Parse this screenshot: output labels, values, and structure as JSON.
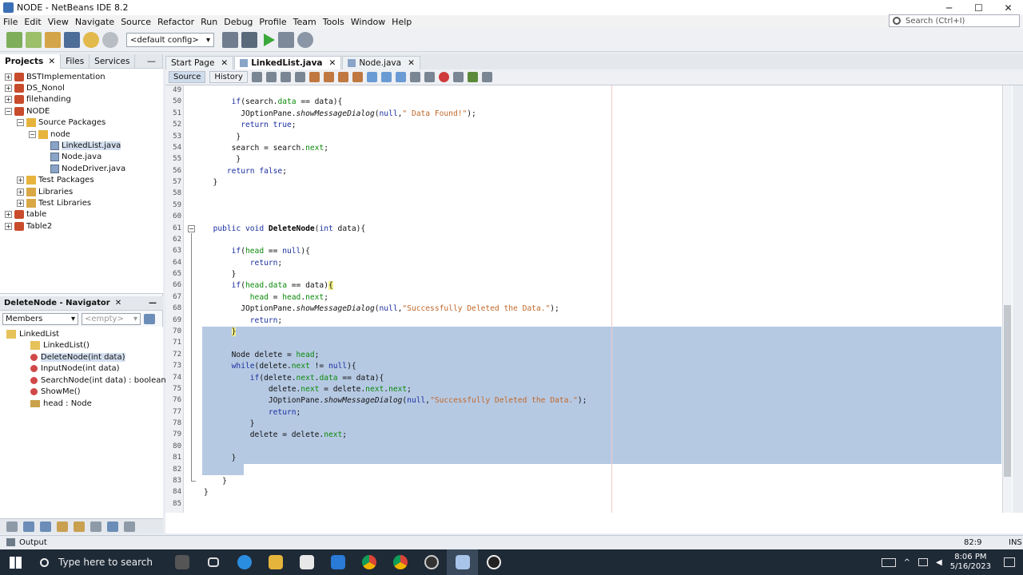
{
  "window": {
    "title": "NODE - NetBeans IDE 8.2",
    "min": "─",
    "max": "☐",
    "close": "✕"
  },
  "menu": [
    "File",
    "Edit",
    "View",
    "Navigate",
    "Source",
    "Refactor",
    "Run",
    "Debug",
    "Profile",
    "Team",
    "Tools",
    "Window",
    "Help"
  ],
  "search": {
    "placeholder": "Search (Ctrl+I)"
  },
  "toolbar": {
    "config": "<default config>"
  },
  "left_tabs": [
    "Projects",
    "Files",
    "Services"
  ],
  "project_tree": [
    {
      "label": "BSTImplementation",
      "level": 0,
      "kind": "proj",
      "exp": "+"
    },
    {
      "label": "DS_Nonol",
      "level": 0,
      "kind": "proj",
      "exp": "+"
    },
    {
      "label": "filehanding",
      "level": 0,
      "kind": "proj",
      "exp": "+"
    },
    {
      "label": "NODE",
      "level": 0,
      "kind": "proj",
      "exp": "−"
    },
    {
      "label": "Source Packages",
      "level": 1,
      "kind": "pkg",
      "exp": "−"
    },
    {
      "label": "node",
      "level": 2,
      "kind": "pkg",
      "exp": "−"
    },
    {
      "label": "LinkedList.java",
      "level": 3,
      "kind": "java",
      "exp": "",
      "selected": true
    },
    {
      "label": "Node.java",
      "level": 3,
      "kind": "java",
      "exp": ""
    },
    {
      "label": "NodeDriver.java",
      "level": 3,
      "kind": "java",
      "exp": ""
    },
    {
      "label": "Test Packages",
      "level": 1,
      "kind": "pkg",
      "exp": "+"
    },
    {
      "label": "Libraries",
      "level": 1,
      "kind": "folder",
      "exp": "+"
    },
    {
      "label": "Test Libraries",
      "level": 1,
      "kind": "folder",
      "exp": "+"
    },
    {
      "label": "table",
      "level": 0,
      "kind": "proj",
      "exp": "+"
    },
    {
      "label": "Table2",
      "level": 0,
      "kind": "proj",
      "exp": "+"
    }
  ],
  "navigator": {
    "title": "DeleteNode - Navigator",
    "members": "Members",
    "filter": "<empty>",
    "items": [
      {
        "label": "LinkedList",
        "level": 0,
        "kind": "cls"
      },
      {
        "label": "LinkedList()",
        "level": 1,
        "kind": "cons"
      },
      {
        "label": "DeleteNode(int data)",
        "level": 1,
        "kind": "meth",
        "selected": true
      },
      {
        "label": "InputNode(int data)",
        "level": 1,
        "kind": "meth"
      },
      {
        "label": "SearchNode(int data) : boolean",
        "level": 1,
        "kind": "meth"
      },
      {
        "label": "ShowMe()",
        "level": 1,
        "kind": "meth"
      },
      {
        "label": "head : Node",
        "level": 1,
        "kind": "fld"
      }
    ]
  },
  "editor_tabs": [
    {
      "label": "Start Page",
      "active": false
    },
    {
      "label": "LinkedList.java",
      "active": true
    },
    {
      "label": "Node.java",
      "active": false
    }
  ],
  "editor_views": [
    "Source",
    "History"
  ],
  "code": [
    {
      "n": "49",
      "t": []
    },
    {
      "n": "50",
      "t": [
        [
          "      ",
          ""
        ],
        [
          "if",
          "kw"
        ],
        [
          "(search.",
          ""
        ],
        [
          "data",
          "fld"
        ],
        [
          " == data){",
          ""
        ]
      ]
    },
    {
      "n": "51",
      "t": [
        [
          "        JOptionPane.",
          ""
        ],
        [
          "showMessageDialog",
          "it"
        ],
        [
          "(",
          ""
        ],
        [
          "null",
          "kw"
        ],
        [
          ",",
          ""
        ],
        [
          "\" Data Found!\"",
          "str"
        ],
        [
          ");",
          ""
        ]
      ]
    },
    {
      "n": "52",
      "t": [
        [
          "        ",
          ""
        ],
        [
          "return true",
          "kw"
        ],
        [
          ";",
          ""
        ]
      ]
    },
    {
      "n": "53",
      "t": [
        [
          "       }",
          ""
        ]
      ]
    },
    {
      "n": "54",
      "t": [
        [
          "      search = search.",
          ""
        ],
        [
          "next",
          "fld"
        ],
        [
          ";",
          ""
        ]
      ]
    },
    {
      "n": "55",
      "t": [
        [
          "       }",
          ""
        ]
      ]
    },
    {
      "n": "56",
      "t": [
        [
          "     ",
          ""
        ],
        [
          "return false",
          "kw"
        ],
        [
          ";",
          ""
        ]
      ]
    },
    {
      "n": "57",
      "t": [
        [
          "  }",
          ""
        ]
      ]
    },
    {
      "n": "58",
      "t": []
    },
    {
      "n": "59",
      "t": []
    },
    {
      "n": "60",
      "t": []
    },
    {
      "n": "61",
      "t": [
        [
          "  ",
          ""
        ],
        [
          "public void",
          "kw"
        ],
        [
          " ",
          ""
        ],
        [
          "DeleteNode",
          "fn"
        ],
        [
          "(",
          ""
        ],
        [
          "int",
          "kw"
        ],
        [
          " data){",
          ""
        ]
      ]
    },
    {
      "n": "62",
      "t": []
    },
    {
      "n": "63",
      "t": [
        [
          "      ",
          ""
        ],
        [
          "if",
          "kw"
        ],
        [
          "(",
          ""
        ],
        [
          "head",
          "fld"
        ],
        [
          " == ",
          ""
        ],
        [
          "null",
          "kw"
        ],
        [
          "){",
          ""
        ]
      ]
    },
    {
      "n": "64",
      "t": [
        [
          "          ",
          ""
        ],
        [
          "return",
          "kw"
        ],
        [
          ";",
          ""
        ]
      ]
    },
    {
      "n": "65",
      "t": [
        [
          "      }",
          ""
        ]
      ]
    },
    {
      "n": "66",
      "t": [
        [
          "      ",
          ""
        ],
        [
          "if",
          "kw"
        ],
        [
          "(",
          ""
        ],
        [
          "head",
          "fld"
        ],
        [
          ".",
          ""
        ],
        [
          "data",
          "fld"
        ],
        [
          " == data)",
          ""
        ],
        [
          "{",
          "yel"
        ]
      ]
    },
    {
      "n": "67",
      "t": [
        [
          "          ",
          ""
        ],
        [
          "head",
          "fld"
        ],
        [
          " = ",
          ""
        ],
        [
          "head",
          "fld"
        ],
        [
          ".",
          ""
        ],
        [
          "next",
          "fld"
        ],
        [
          ";",
          ""
        ]
      ]
    },
    {
      "n": "68",
      "t": [
        [
          "        JOptionPane.",
          ""
        ],
        [
          "showMessageDialog",
          "it"
        ],
        [
          "(",
          ""
        ],
        [
          "null",
          "kw"
        ],
        [
          ",",
          ""
        ],
        [
          "\"Successfully Deleted the Data.\"",
          "str"
        ],
        [
          ");",
          ""
        ]
      ]
    },
    {
      "n": "69",
      "t": [
        [
          "          ",
          ""
        ],
        [
          "return",
          "kw"
        ],
        [
          ";",
          ""
        ]
      ]
    },
    {
      "n": "70",
      "t": [
        [
          "      ",
          ""
        ],
        [
          "}",
          "yel"
        ]
      ]
    },
    {
      "n": "71",
      "t": []
    },
    {
      "n": "72",
      "t": [
        [
          "      Node delete = ",
          ""
        ],
        [
          "head",
          "fld"
        ],
        [
          ";",
          ""
        ]
      ]
    },
    {
      "n": "73",
      "t": [
        [
          "      ",
          ""
        ],
        [
          "while",
          "kw"
        ],
        [
          "(delete.",
          ""
        ],
        [
          "next",
          "fld"
        ],
        [
          " != ",
          ""
        ],
        [
          "null",
          "kw"
        ],
        [
          "){",
          ""
        ]
      ]
    },
    {
      "n": "74",
      "t": [
        [
          "          ",
          ""
        ],
        [
          "if",
          "kw"
        ],
        [
          "(delete.",
          ""
        ],
        [
          "next",
          "fld"
        ],
        [
          ".",
          ""
        ],
        [
          "data",
          "fld"
        ],
        [
          " == data){",
          ""
        ]
      ]
    },
    {
      "n": "75",
      "t": [
        [
          "              delete.",
          ""
        ],
        [
          "next",
          "fld"
        ],
        [
          " = delete.",
          ""
        ],
        [
          "next",
          "fld"
        ],
        [
          ".",
          ""
        ],
        [
          "next",
          "fld"
        ],
        [
          ";",
          ""
        ]
      ]
    },
    {
      "n": "76",
      "t": [
        [
          "              JOptionPane.",
          ""
        ],
        [
          "showMessageDialog",
          "it"
        ],
        [
          "(",
          ""
        ],
        [
          "null",
          "kw"
        ],
        [
          ",",
          ""
        ],
        [
          "\"Successfully Deleted the Data.\"",
          "str"
        ],
        [
          ");",
          ""
        ]
      ]
    },
    {
      "n": "77",
      "t": [
        [
          "              ",
          ""
        ],
        [
          "return",
          "kw"
        ],
        [
          ";",
          ""
        ]
      ]
    },
    {
      "n": "78",
      "t": [
        [
          "          }",
          ""
        ]
      ]
    },
    {
      "n": "79",
      "t": [
        [
          "          delete = delete.",
          ""
        ],
        [
          "next",
          "fld"
        ],
        [
          ";",
          ""
        ]
      ]
    },
    {
      "n": "80",
      "t": []
    },
    {
      "n": "81",
      "t": [
        [
          "      }",
          ""
        ]
      ]
    },
    {
      "n": "82",
      "t": []
    },
    {
      "n": "83",
      "t": [
        [
          "    }",
          ""
        ]
      ]
    },
    {
      "n": "84",
      "t": [
        [
          "}",
          ""
        ]
      ]
    },
    {
      "n": "85",
      "t": []
    }
  ],
  "status": {
    "output": "Output",
    "position": "82:9",
    "mode": "INS"
  },
  "taskbar": {
    "search": "Type here to search",
    "time": "8:06 PM",
    "date": "5/16/2023"
  },
  "colors": {
    "selection": "#b6c9e3",
    "keyword": "#1a2fa0",
    "field": "#0b8a0b",
    "string": "#c0682a"
  }
}
